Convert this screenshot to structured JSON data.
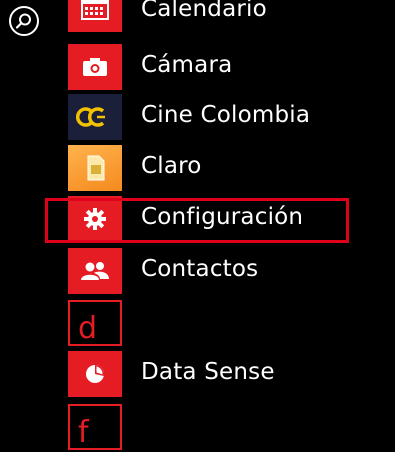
{
  "search": {
    "icon": "search-icon"
  },
  "apps": [
    {
      "name": "Calendario",
      "icon": "calendar-icon",
      "tile": "red"
    },
    {
      "name": "Cámara",
      "icon": "camera-icon",
      "tile": "red"
    },
    {
      "name": "Cine Colombia",
      "icon": "cine-colombia-logo-icon",
      "tile": "dark"
    },
    {
      "name": "Claro",
      "icon": "sim-card-icon",
      "tile": "orange"
    },
    {
      "name": "Configuración",
      "icon": "gear-icon",
      "tile": "red",
      "highlighted": true
    },
    {
      "name": "Contactos",
      "icon": "people-icon",
      "tile": "red"
    },
    {
      "letter": "d"
    },
    {
      "name": "Data Sense",
      "icon": "pie-chart-icon",
      "tile": "red"
    },
    {
      "letter": "f"
    }
  ],
  "colors": {
    "accent": "#e51c23",
    "highlight_border": "#e0001a",
    "background": "#000000"
  }
}
